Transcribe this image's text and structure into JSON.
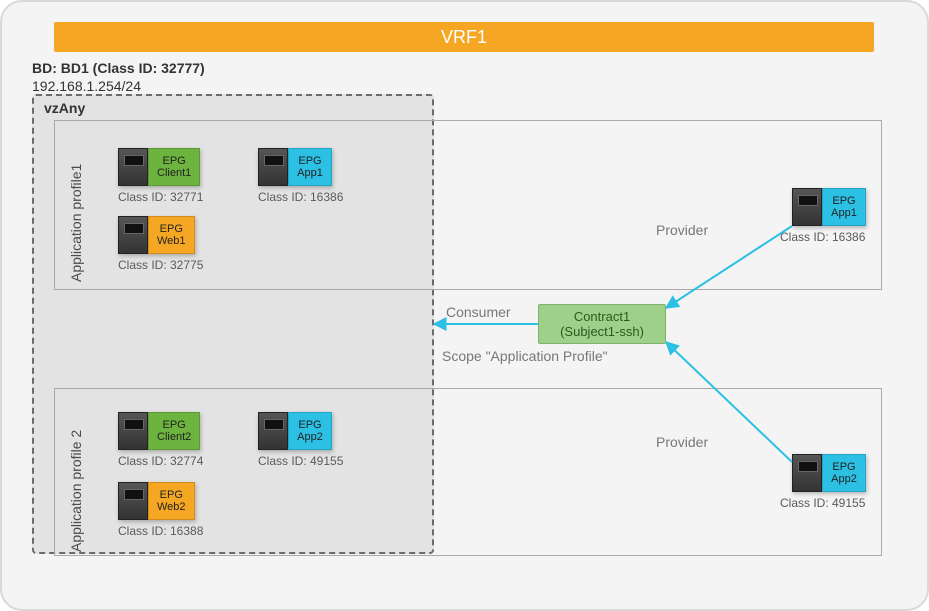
{
  "vrf_title": "VRF1",
  "bd_line1": "BD: BD1 (Class ID: 32777)",
  "bd_line2": "192.168.1.254/24",
  "vzany_label": "vzAny",
  "ap1_label": "Application profile1",
  "ap2_label": "Application profile 2",
  "consumer_label": "Consumer",
  "provider_label": "Provider",
  "contract_name": "Contract1",
  "contract_subject": "(Subject1-ssh)",
  "scope_text": "Scope \"Application Profile\"",
  "epg_prefix": "EPG",
  "vzany_ap1": {
    "client": {
      "name": "Client1",
      "classid": "Class ID: 32771"
    },
    "app": {
      "name": "App1",
      "classid": "Class ID: 16386"
    },
    "web": {
      "name": "Web1",
      "classid": "Class ID: 32775"
    }
  },
  "vzany_ap2": {
    "client": {
      "name": "Client2",
      "classid": "Class ID: 32774"
    },
    "app": {
      "name": "App2",
      "classid": "Class ID: 49155"
    },
    "web": {
      "name": "Web2",
      "classid": "Class ID: 16388"
    }
  },
  "provider_ap1": {
    "name": "App1",
    "classid": "Class ID: 16386"
  },
  "provider_ap2": {
    "name": "App2",
    "classid": "Class ID: 49155"
  }
}
